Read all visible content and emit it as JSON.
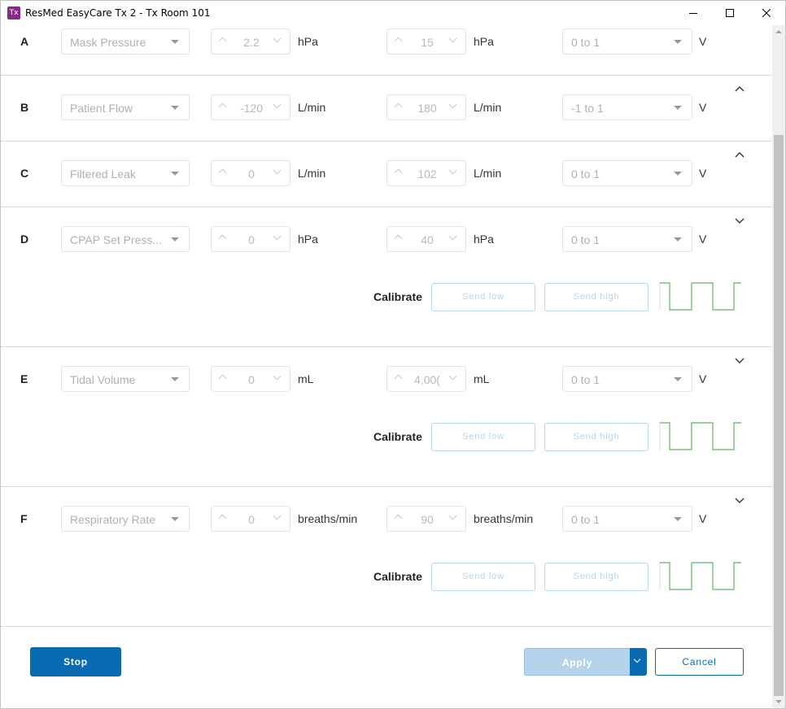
{
  "window": {
    "icon_text": "Tx",
    "title": "ResMed EasyCare Tx 2 - Tx Room 101"
  },
  "channels": [
    {
      "label": "A",
      "signal": "Mask Pressure",
      "low": "2.2",
      "low_unit": "hPa",
      "high": "15",
      "high_unit": "hPa",
      "voltage": "0 to 1",
      "voltage_unit": "V",
      "expand_icon": "none",
      "calibrate": false
    },
    {
      "label": "B",
      "signal": "Patient Flow",
      "low": "-120",
      "low_unit": "L/min",
      "high": "180",
      "high_unit": "L/min",
      "voltage": "-1 to 1",
      "voltage_unit": "V",
      "expand_icon": "chevron-up-icon",
      "calibrate": false
    },
    {
      "label": "C",
      "signal": "Filtered Leak",
      "low": "0",
      "low_unit": "L/min",
      "high": "102",
      "high_unit": "L/min",
      "voltage": "0 to 1",
      "voltage_unit": "V",
      "expand_icon": "chevron-up-icon",
      "calibrate": false
    },
    {
      "label": "D",
      "signal": "CPAP Set Press...",
      "low": "0",
      "low_unit": "hPa",
      "high": "40",
      "high_unit": "hPa",
      "voltage": "0 to 1",
      "voltage_unit": "V",
      "expand_icon": "chevron-down-icon",
      "calibrate": true
    },
    {
      "label": "E",
      "signal": "Tidal Volume",
      "low": "0",
      "low_unit": "mL",
      "high": "4,00(",
      "high_unit": "mL",
      "voltage": "0 to 1",
      "voltage_unit": "V",
      "expand_icon": "chevron-down-icon",
      "calibrate": true
    },
    {
      "label": "F",
      "signal": "Respiratory Rate",
      "low": "0",
      "low_unit": "breaths/min",
      "high": "90",
      "high_unit": "breaths/min",
      "voltage": "0 to 1",
      "voltage_unit": "V",
      "expand_icon": "chevron-down-icon",
      "calibrate": true
    }
  ],
  "calibrate": {
    "label": "Calibrate",
    "send_low": "Send low",
    "send_high": "Send high"
  },
  "footer": {
    "stop": "Stop",
    "apply": "Apply",
    "cancel": "Cancel"
  },
  "colors": {
    "accent": "#0a6ab1",
    "wave": "#5cb85c",
    "title_icon": "#8a2a88"
  }
}
